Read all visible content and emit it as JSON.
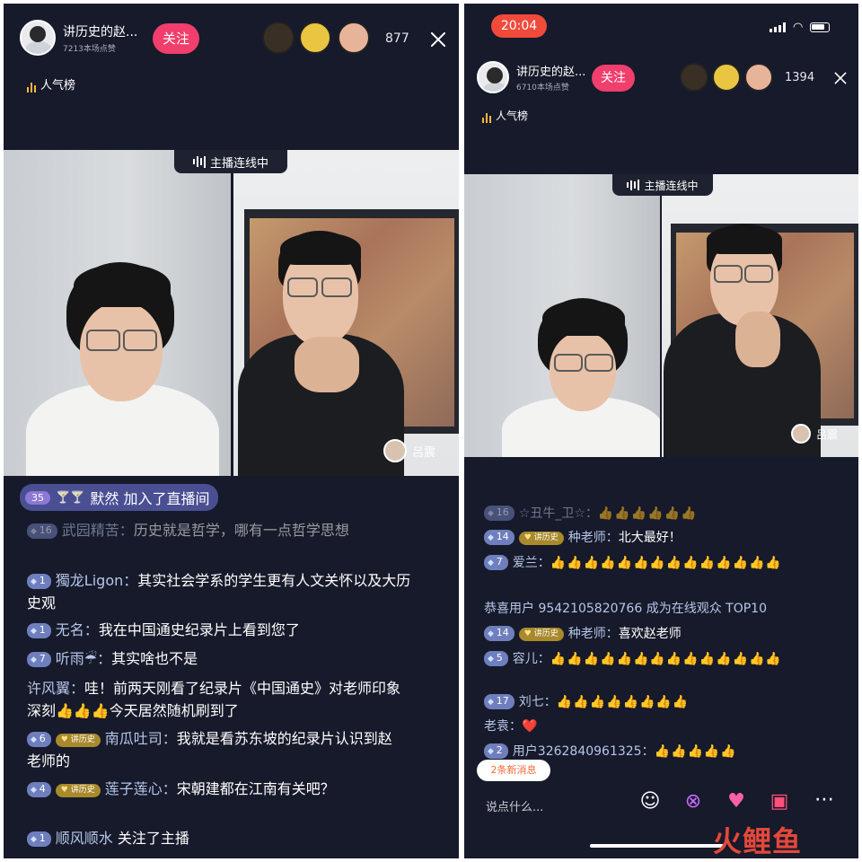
{
  "left": {
    "host": {
      "name": "讲历史的赵...",
      "likes": "7213本场点赞",
      "follow": "关注"
    },
    "viewer_count": "877",
    "rank_label": "人气榜",
    "connect_label": "主播连线中",
    "guest_name": "吕震",
    "join": {
      "level": "35",
      "text": "默然 加入了直播间"
    },
    "chat": [
      {
        "level": "",
        "name": "",
        "text": "历史就是哲学，哪有一点哲学思想"
      },
      {
        "level": "1",
        "name": "獨龙Ligon：",
        "text": "其实社会学系的学生更有人文关怀以及大历史观"
      },
      {
        "level": "1",
        "name": "无名：",
        "text": "我在中国通史纪录片上看到您了"
      },
      {
        "level": "7",
        "name": "听雨☔：",
        "text": "其实啥也不是"
      },
      {
        "level": "",
        "name": "许风翼：",
        "text": "哇！前两天刚看了纪录片《中国通史》对老师印象深刻👍👍👍今天居然随机刷到了"
      },
      {
        "level": "6",
        "fan": "讲历史",
        "name": "南瓜吐司：",
        "text": "我就是看苏东坡的纪录片认识到赵老师的"
      },
      {
        "level": "4",
        "fan": "讲历史",
        "name": "莲子莲心：",
        "text": "宋朝建都在江南有关吧？"
      },
      {
        "level": "1",
        "name": "顺风顺水",
        "text": "关注了主播"
      }
    ]
  },
  "right": {
    "time": "20:04",
    "host": {
      "name": "讲历史的赵...",
      "likes": "6710本场点赞",
      "follow": "关注"
    },
    "viewer_count": "1394",
    "rank_label": "人气榜",
    "connect_label": "主播连线中",
    "guest_name": "吕震",
    "chat": [
      {
        "level": "16",
        "name": "☆丑牛_卫☆：",
        "text": "👍👍👍👍👍👍"
      },
      {
        "level": "14",
        "fan": "讲历史",
        "name": "种老师：",
        "text": "北大最好！"
      },
      {
        "level": "7",
        "name": "爱兰：",
        "text": "👍👍👍👍👍👍👍👍👍👍👍👍👍👍"
      },
      {
        "level": "",
        "name": "",
        "text": "恭喜用户 9542105820766 成为在线观众 TOP10"
      },
      {
        "level": "14",
        "fan": "讲历史",
        "name": "种老师：",
        "text": "喜欢赵老师"
      },
      {
        "level": "5",
        "name": "容儿：",
        "text": "👍👍👍👍👍👍👍👍👍👍👍👍👍👍"
      },
      {
        "level": "17",
        "name": "刘七：",
        "text": "👍👍👍👍👍👍👍👍"
      },
      {
        "level": "",
        "name": "老袁：",
        "text": "❤️"
      },
      {
        "level": "2",
        "name": "用户3262840961325：",
        "text": "👍👍👍👍👍"
      }
    ],
    "new_messages": "2条新消息",
    "input_placeholder": "说点什么...",
    "icons": [
      "smile-icon",
      "link-icon",
      "heart-box-icon",
      "gift-icon",
      "more-icon"
    ]
  },
  "watermark": "火鲤鱼"
}
